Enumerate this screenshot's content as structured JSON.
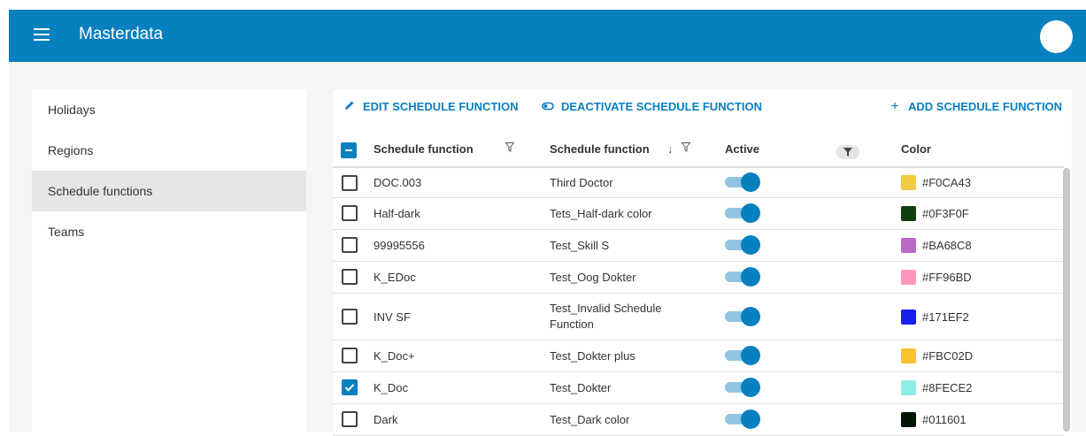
{
  "header": {
    "title": "Masterdata"
  },
  "sidebar": {
    "items": [
      {
        "label": "Holidays"
      },
      {
        "label": "Regions"
      },
      {
        "label": "Schedule functions"
      },
      {
        "label": "Teams"
      }
    ]
  },
  "actions": {
    "edit": "EDIT SCHEDULE FUNCTION",
    "deactivate": "DEACTIVATE SCHEDULE FUNCTION",
    "add": "ADD SCHEDULE FUNCTION"
  },
  "table": {
    "headers": {
      "code": "Schedule function",
      "name": "Schedule function",
      "active": "Active",
      "color": "Color"
    },
    "rows": [
      {
        "code": "DOC.003",
        "name": "Third Doctor",
        "color": "#F0CA43",
        "swatch": "#F0CA43",
        "checked": false
      },
      {
        "code": "Half-dark",
        "name": "Tets_Half-dark color",
        "color": "#0F3F0F",
        "swatch": "#0F3F0F",
        "checked": false
      },
      {
        "code": "99995556",
        "name": "Test_Skill S",
        "color": "#BA68C8",
        "swatch": "#BA68C8",
        "checked": false
      },
      {
        "code": "K_EDoc",
        "name": "Test_Oog Dokter",
        "color": "#FF96BD",
        "swatch": "#FF96BD",
        "checked": false
      },
      {
        "code": "INV SF",
        "name": "Test_Invalid Schedule Function",
        "color": "#171EF2",
        "swatch": "#171EF2",
        "checked": false
      },
      {
        "code": "K_Doc+",
        "name": "Test_Dokter plus",
        "color": "#FBC02D",
        "swatch": "#FBC02D",
        "checked": false
      },
      {
        "code": "K_Doc",
        "name": "Test_Dokter",
        "color": "#8FECE2",
        "swatch": "#8FECE2",
        "checked": true
      },
      {
        "code": "Dark",
        "name": "Test_Dark color",
        "color": "#011601",
        "swatch": "#011601",
        "checked": false
      }
    ]
  },
  "colors": {
    "primary": "#0880C0"
  }
}
